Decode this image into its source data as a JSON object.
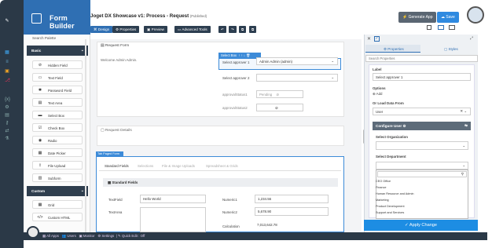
{
  "app": {
    "title": "Form Builder",
    "search_palette": "Search Palette"
  },
  "page": {
    "title": "Joget DX Showcase v1: Process - Request",
    "status": "(Published)"
  },
  "toolbar": {
    "design": "Design",
    "properties": "Properties",
    "preview": "Preview",
    "advanced": "Advanced Tools",
    "generate_app": "Generate App",
    "save": "Save"
  },
  "palette": {
    "basic": "Basic",
    "custom": "Custom",
    "items": [
      {
        "label": "Hidden Field",
        "icon": "eye-slash-icon"
      },
      {
        "label": "Text Field",
        "icon": "text-field-icon"
      },
      {
        "label": "Password Field",
        "icon": "asterisk-icon"
      },
      {
        "label": "Text Area",
        "icon": "text-area-icon"
      },
      {
        "label": "Select Box",
        "icon": "select-box-icon"
      },
      {
        "label": "Check Box",
        "icon": "check-box-icon"
      },
      {
        "label": "Radio",
        "icon": "radio-icon"
      },
      {
        "label": "Date Picker",
        "icon": "calendar-icon"
      },
      {
        "label": "File Upload",
        "icon": "upload-icon"
      },
      {
        "label": "Subform",
        "icon": "subform-icon"
      }
    ],
    "custom_items": [
      {
        "label": "Grid",
        "icon": "grid-icon"
      },
      {
        "label": "Custom HTML",
        "icon": "code-icon"
      }
    ]
  },
  "form": {
    "section1_title": "Request Form",
    "welcome": "Welcome Admin Admin.",
    "select_box_tag": "Select Box",
    "approver1_label": "Select approver 1",
    "approver1_value": "Admin Admin (admin)",
    "approver2_label": "Select approver 2",
    "approval1_label": "approvalStatus1",
    "approval1_value": "Pending",
    "approval2_label": "approvalStatus2",
    "section2_title": "Request Details",
    "tab_tag": "Tab Paged Form",
    "tabs": [
      "Standard Fields",
      "Selections",
      "File & Image Uploads",
      "Spreadsheet & Grids"
    ],
    "standard_fields_title": "Standard Fields",
    "textfield_label": "TextField",
    "textfield_value": "Hello World",
    "textarea_label": "TextArea",
    "numeric1_label": "Numeric1",
    "numeric1_value": "1,234.56",
    "numeric2_label": "Numeric2",
    "numeric2_value": "5,678.90",
    "calc_label": "Calculation",
    "calc_value": "7,013,642.78"
  },
  "properties": {
    "tab_properties": "Properties",
    "tab_styles": "Styles",
    "search_placeholder": "Search Properties",
    "label_title": "Label",
    "label_value": "Select approver 1",
    "options_title": "Options",
    "add_label": "Add",
    "or_load_title": "Or Load Data From",
    "or_load_value": "User",
    "configure_user": "Configure User",
    "select_org": "Select Organization",
    "select_dept": "Select Department",
    "dept_options": [
      "CEO Office",
      "Finance",
      "Human Resource and Admin",
      "Marketing",
      "Product Development",
      "Support and Services"
    ],
    "apply": "Apply Change"
  },
  "bottom": {
    "all_apps": "All Apps",
    "users": "Users",
    "monitor": "Monitor",
    "settings": "Settings",
    "quick_edit": "Quick Edit : Off"
  },
  "colors": {
    "brand_blue": "#2f6fb3",
    "dark_navy": "#2b3947",
    "apply_blue": "#1d8de3",
    "generate_gray": "#5a6672"
  }
}
